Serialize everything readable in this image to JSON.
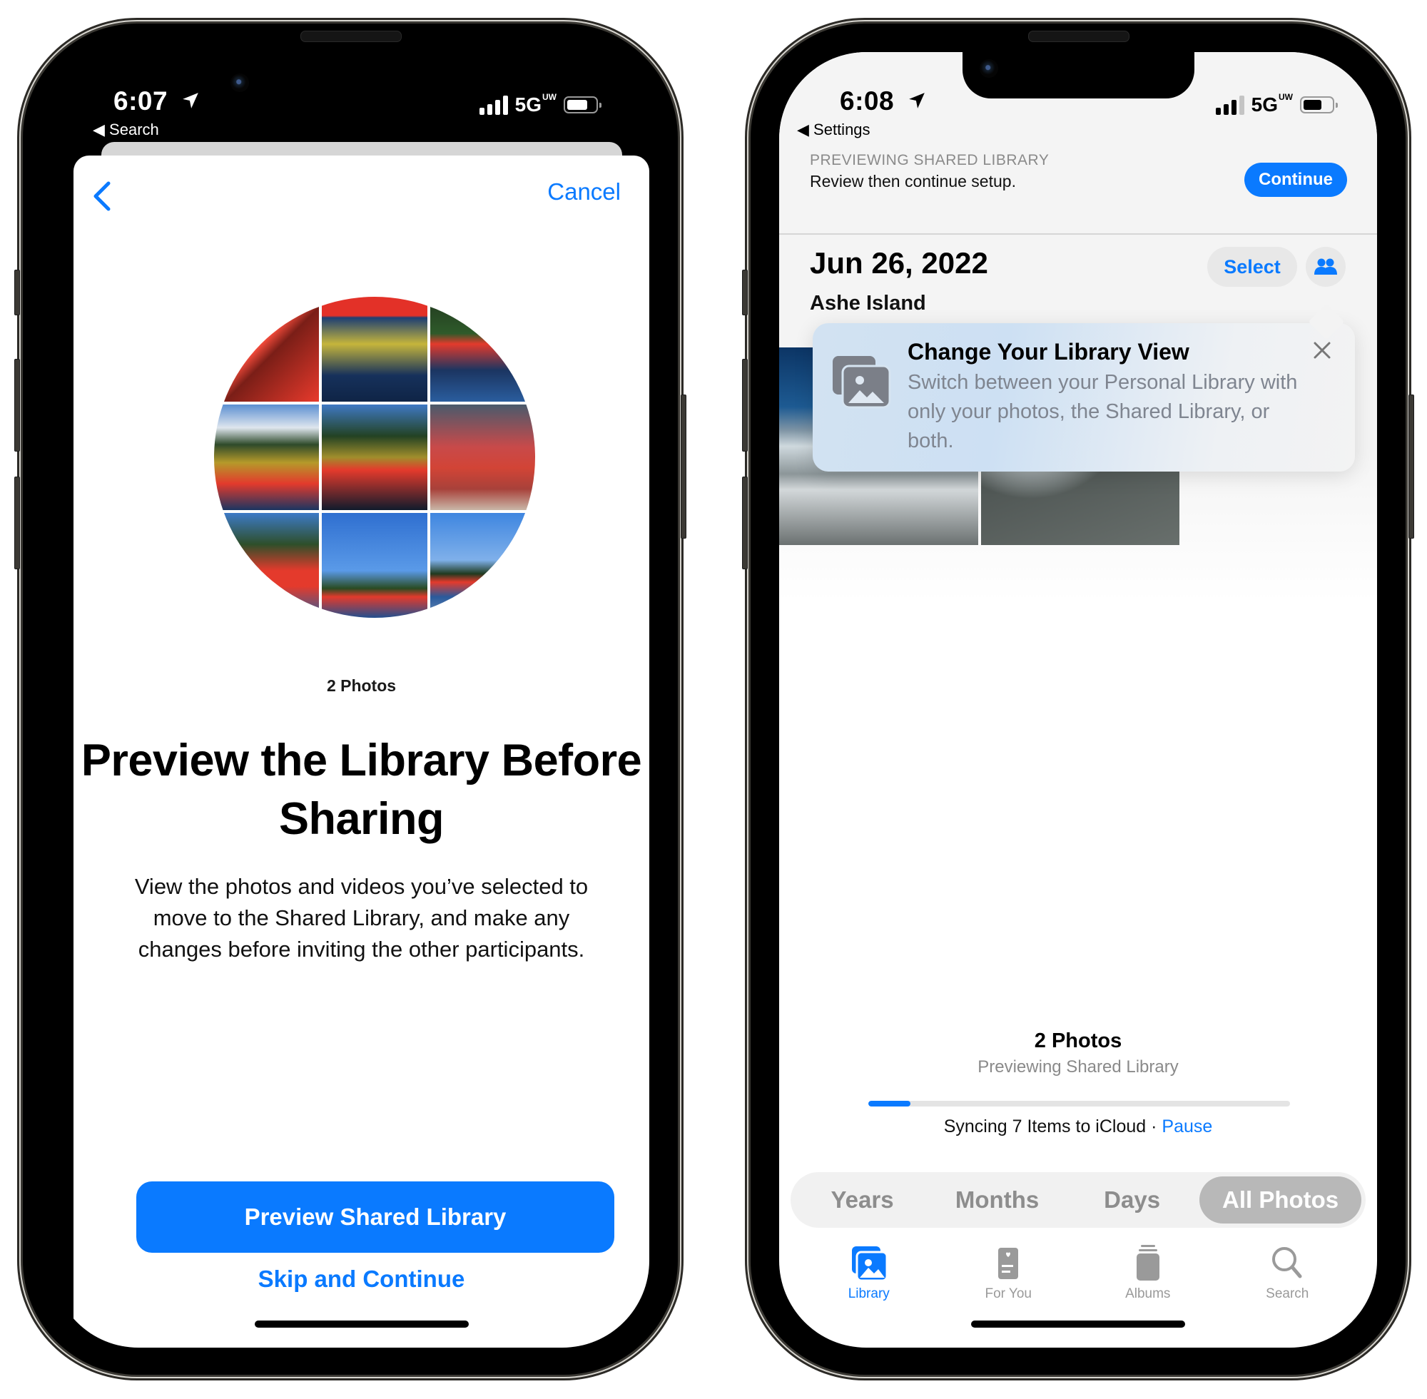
{
  "left_phone": {
    "status_bar": {
      "time": "6:07",
      "back_app": "Search",
      "network": "5G",
      "network_badge": "UW",
      "battery_percent": 60
    },
    "nav": {
      "back_icon": "chevron-left-icon",
      "cancel_label": "Cancel"
    },
    "collage": {
      "tiles": [
        "linear-gradient(135deg,#e23b2e 0%,#f24a3a 45%,#7a1e17 55%,#e83a2c 100%)",
        "linear-gradient(180deg,#e33128 0%,#e33128 18%,#1d3f73 20%,#c5b53b 45%,#16315b 75%,#0f2446 100%)",
        "linear-gradient(180deg,#22391f 0%,#2e5a2a 35%,#e33a2c 45%,#1b3561 70%,#2a5d9e 100%)",
        "linear-gradient(180deg,#5b8fd1 0%,#dfe6ee 22%,#2e4a2a 38%,#b59a2a 55%,#e33a2c 75%,#1b3561 100%)",
        "linear-gradient(180deg,#3f79c4 0%,#234223 30%,#a08e2c 50%,#e43a2c 62%,#101b2c 100%)",
        "linear-gradient(180deg,#4a5a6c 0%,#c84a4a 40%,#d24436 60%,#a8413a 80%,#c9b7a8 100%)",
        "linear-gradient(180deg,#3d7ac7 0%,#2e4f2a 30%,#e43a2c 55%,#e43a2c 70%,#2a5e9c 100%)",
        "linear-gradient(180deg,#2f6fd0 0%,#5a9ae8 55%,#2a4b22 72%,#e23a2c 80%,#224f8f 100%)",
        "linear-gradient(180deg,#3f86e0 0%,#7fb0ea 45%,#1f3a20 58%,#e43a2c 66%,#2a5a9c 80%,#6e8fb8 100%)"
      ]
    },
    "photos_count": "2 Photos",
    "headline": "Preview the Library Before Sharing",
    "description": "View the photos and videos you’ve selected to move to the Shared Library, and make any changes before inviting the other participants.",
    "primary_button": "Preview Shared Library",
    "secondary_button": "Skip and Continue"
  },
  "right_phone": {
    "status_bar": {
      "time": "6:08",
      "back_app": "Settings",
      "network": "5G",
      "network_badge": "UW",
      "battery_percent": 55
    },
    "preview_banner": {
      "caption": "PREVIEWING SHARED LIBRARY",
      "subtitle": "Review then continue setup.",
      "continue_label": "Continue"
    },
    "header": {
      "date": "Jun 26, 2022",
      "location": "Ashe Island",
      "select_label": "Select",
      "library_switch_icon": "people-icon"
    },
    "tip": {
      "title": "Change Your Library View",
      "body": "Switch between your Personal Library with only your photos, the Shared Library, or both.",
      "icon": "photo-stack-icon",
      "close_icon": "close-icon"
    },
    "summary": {
      "count": "2 Photos",
      "subtitle": "Previewing Shared Library",
      "sync_progress_percent": 10,
      "sync_text": "Syncing 7 Items to iCloud · ",
      "pause_label": "Pause"
    },
    "view_segments": [
      {
        "label": "Years",
        "active": false
      },
      {
        "label": "Months",
        "active": false
      },
      {
        "label": "Days",
        "active": false
      },
      {
        "label": "All Photos",
        "active": true
      }
    ],
    "tab_bar": [
      {
        "label": "Library",
        "icon": "library-icon",
        "active": true
      },
      {
        "label": "For You",
        "icon": "for-you-icon",
        "active": false
      },
      {
        "label": "Albums",
        "icon": "albums-icon",
        "active": false
      },
      {
        "label": "Search",
        "icon": "search-icon",
        "active": false
      }
    ]
  },
  "colors": {
    "accent": "#0a7aff",
    "inactive_gray": "#9a9a9a",
    "segment_active": "#b8b8b8"
  }
}
